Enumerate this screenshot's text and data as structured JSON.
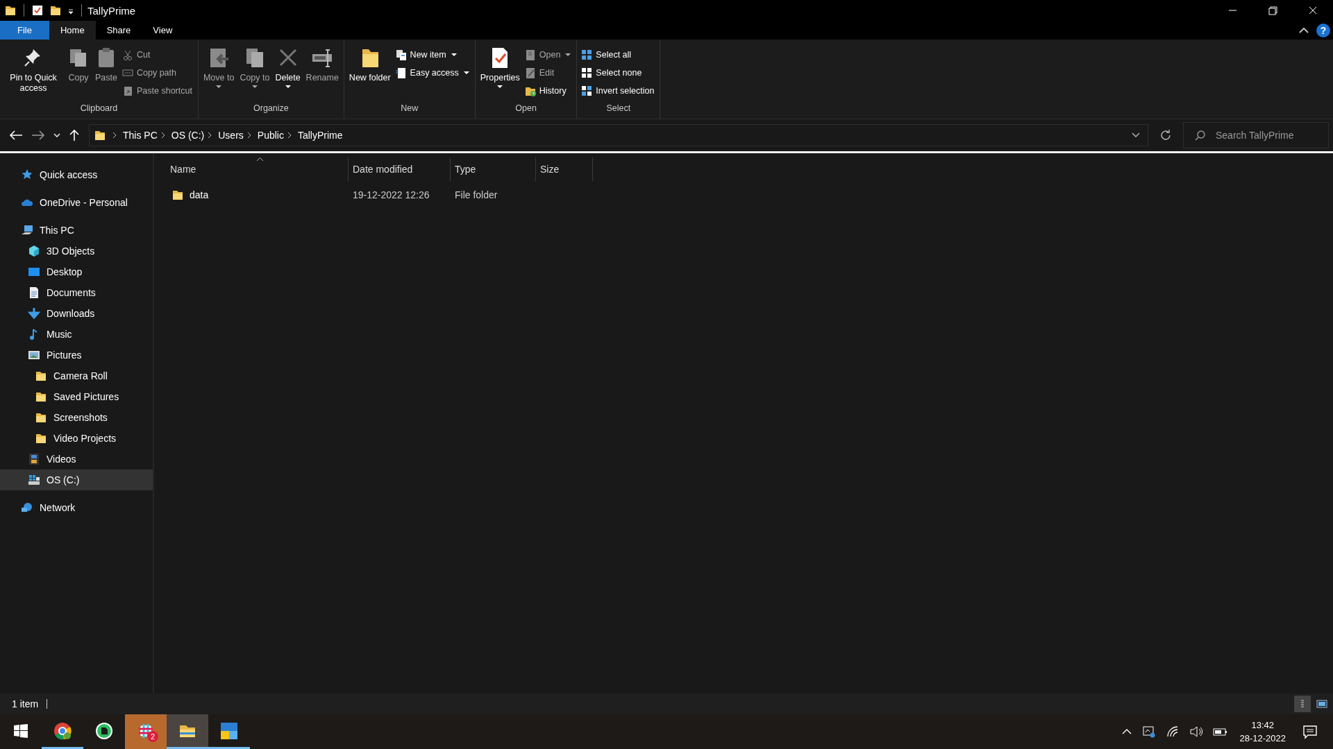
{
  "window": {
    "title": "TallyPrime",
    "help_button": "?"
  },
  "ribbon_tabs": [
    {
      "label": "File",
      "kind": "file",
      "selected": false
    },
    {
      "label": "Home",
      "kind": "tab",
      "selected": true
    },
    {
      "label": "Share",
      "kind": "tab",
      "selected": false
    },
    {
      "label": "View",
      "kind": "tab",
      "selected": false
    }
  ],
  "ribbon": {
    "groups": [
      {
        "label": "Clipboard",
        "columns": [
          {
            "kind": "large",
            "buttons": [
              {
                "label": "Pin to Quick access",
                "disabled": false,
                "dropdown": false
              }
            ]
          },
          {
            "kind": "large",
            "buttons": [
              {
                "label": "Copy",
                "disabled": true,
                "dropdown": false
              }
            ]
          },
          {
            "kind": "large",
            "buttons": [
              {
                "label": "Paste",
                "disabled": true,
                "dropdown": false
              }
            ]
          },
          {
            "kind": "stack",
            "buttons": [
              {
                "label": "Cut",
                "disabled": true,
                "dropdown": false
              },
              {
                "label": "Copy path",
                "disabled": true,
                "dropdown": false
              },
              {
                "label": "Paste shortcut",
                "disabled": true,
                "dropdown": false
              }
            ]
          }
        ]
      },
      {
        "label": "Organize",
        "columns": [
          {
            "kind": "large",
            "buttons": [
              {
                "label": "Move to",
                "disabled": true,
                "dropdown": true
              }
            ]
          },
          {
            "kind": "large",
            "buttons": [
              {
                "label": "Copy to",
                "disabled": true,
                "dropdown": true
              }
            ]
          },
          {
            "kind": "large",
            "buttons": [
              {
                "label": "Delete",
                "disabled": false,
                "dropdown": true
              }
            ]
          },
          {
            "kind": "large",
            "buttons": [
              {
                "label": "Rename",
                "disabled": true,
                "dropdown": false
              }
            ]
          }
        ]
      },
      {
        "label": "New",
        "columns": [
          {
            "kind": "large",
            "buttons": [
              {
                "label": "New folder",
                "disabled": false,
                "dropdown": false
              }
            ]
          },
          {
            "kind": "stack",
            "buttons": [
              {
                "label": "New item",
                "disabled": false,
                "dropdown": true
              },
              {
                "label": "Easy access",
                "disabled": false,
                "dropdown": true
              }
            ]
          }
        ]
      },
      {
        "label": "Open",
        "columns": [
          {
            "kind": "large",
            "buttons": [
              {
                "label": "Properties",
                "disabled": false,
                "dropdown": true
              }
            ]
          },
          {
            "kind": "stack",
            "buttons": [
              {
                "label": "Open",
                "disabled": true,
                "dropdown": true
              },
              {
                "label": "Edit",
                "disabled": true,
                "dropdown": false
              },
              {
                "label": "History",
                "disabled": false,
                "dropdown": false
              }
            ]
          }
        ]
      },
      {
        "label": "Select",
        "columns": [
          {
            "kind": "stack",
            "buttons": [
              {
                "label": "Select all",
                "disabled": false,
                "dropdown": false
              },
              {
                "label": "Select none",
                "disabled": false,
                "dropdown": false
              },
              {
                "label": "Invert selection",
                "disabled": false,
                "dropdown": false
              }
            ]
          }
        ]
      }
    ]
  },
  "address_bar": {
    "breadcrumbs": [
      {
        "label": "This PC"
      },
      {
        "label": "OS (C:)"
      },
      {
        "label": "Users"
      },
      {
        "label": "Public"
      },
      {
        "label": "TallyPrime"
      }
    ]
  },
  "search": {
    "placeholder": "Search TallyPrime"
  },
  "sidebar": {
    "items": [
      {
        "label": "Quick access",
        "kind": "star",
        "selected": false
      },
      {
        "label": "OneDrive - Personal",
        "kind": "cloud",
        "selected": false
      },
      {
        "label": "This PC",
        "kind": "computer",
        "selected": false,
        "children": [
          {
            "label": "3D Objects",
            "kind": "cube",
            "selected": false
          },
          {
            "label": "Desktop",
            "kind": "desktop",
            "selected": false
          },
          {
            "label": "Documents",
            "kind": "document",
            "selected": false
          },
          {
            "label": "Downloads",
            "kind": "download",
            "selected": false
          },
          {
            "label": "Music",
            "kind": "music",
            "selected": false
          },
          {
            "label": "Pictures",
            "kind": "picture",
            "selected": false,
            "children": [
              {
                "label": "Camera Roll",
                "kind": "folder",
                "selected": false
              },
              {
                "label": "Saved Pictures",
                "kind": "folder",
                "selected": false
              },
              {
                "label": "Screenshots",
                "kind": "folder",
                "selected": false
              },
              {
                "label": "Video Projects",
                "kind": "folder",
                "selected": false
              }
            ]
          },
          {
            "label": "Videos",
            "kind": "video",
            "selected": false
          },
          {
            "label": "OS (C:)",
            "kind": "drive",
            "selected": true
          }
        ]
      },
      {
        "label": "Network",
        "kind": "network",
        "selected": false
      }
    ]
  },
  "table": {
    "columns": [
      {
        "label": "Name",
        "sorted": true
      },
      {
        "label": "Date modified",
        "sorted": false
      },
      {
        "label": "Type",
        "sorted": false
      },
      {
        "label": "Size",
        "sorted": false
      }
    ],
    "rows": [
      {
        "name": "data",
        "date_modified": "19-12-2022 12:26",
        "type": "File folder"
      }
    ]
  },
  "status_bar": {
    "text": "1 item",
    "views": [
      {
        "kind": "details",
        "selected": true
      },
      {
        "kind": "tiles",
        "selected": false
      }
    ]
  },
  "taskbar": {
    "apps": [
      {
        "kind": "chrome",
        "running": true,
        "active": false,
        "flashing": false
      },
      {
        "kind": "evernote",
        "running": false,
        "active": false,
        "flashing": false
      },
      {
        "kind": "slack",
        "running": false,
        "active": false,
        "flashing": true,
        "badge": "2"
      },
      {
        "kind": "explorer",
        "running": true,
        "active": true,
        "flashing": false
      },
      {
        "kind": "app",
        "running": true,
        "active": false,
        "flashing": false
      }
    ],
    "time": "13:42",
    "date": "28-12-2022"
  }
}
